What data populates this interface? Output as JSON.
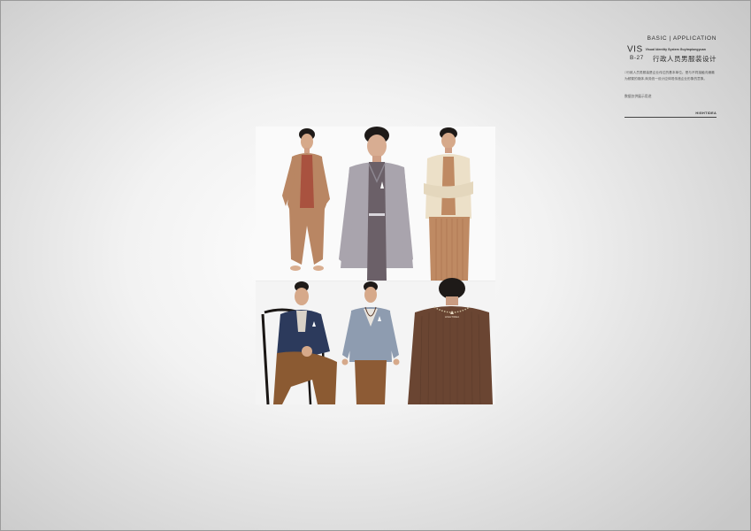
{
  "header": {
    "basic_application": "BASIC | APPLICATION",
    "vis": "VIS",
    "vis_subtitle": "Visual Identity System  Guyimpiongyuan",
    "page_code": "B-27",
    "page_title": "行政人员男服装设计",
    "description": "□行政人员男服装是企业传达的基本单位。是与不同接触沟通最为频繁的媒体,商务统一设计应体现传递企业形象的意象。",
    "note": "数据仅供展示用途",
    "brand": "HIGHTIDEA",
    "text_color": "#2e2e2e"
  },
  "collage": {
    "photos": [
      {
        "name": "photo-tan-outfit",
        "colors": {
          "main": "#b98663",
          "accent": "#a9523f"
        }
      },
      {
        "name": "photo-grey-cardigan",
        "colors": {
          "main": "#a9a4ad",
          "accent": "#6b6068"
        }
      },
      {
        "name": "photo-cream-cardigan",
        "colors": {
          "main": "#ece0c8",
          "accent": "#bf8a63"
        }
      },
      {
        "name": "photo-navy-jacket-seated",
        "colors": {
          "main": "#2c3a5c",
          "accent": "#8b5a32"
        }
      },
      {
        "name": "photo-blue-vneck",
        "colors": {
          "main": "#8e9cb0",
          "accent": "#8d5b35"
        }
      },
      {
        "name": "photo-brown-knit-back",
        "colors": {
          "main": "#6a4532",
          "accent": "#5a3a2a"
        }
      }
    ]
  }
}
